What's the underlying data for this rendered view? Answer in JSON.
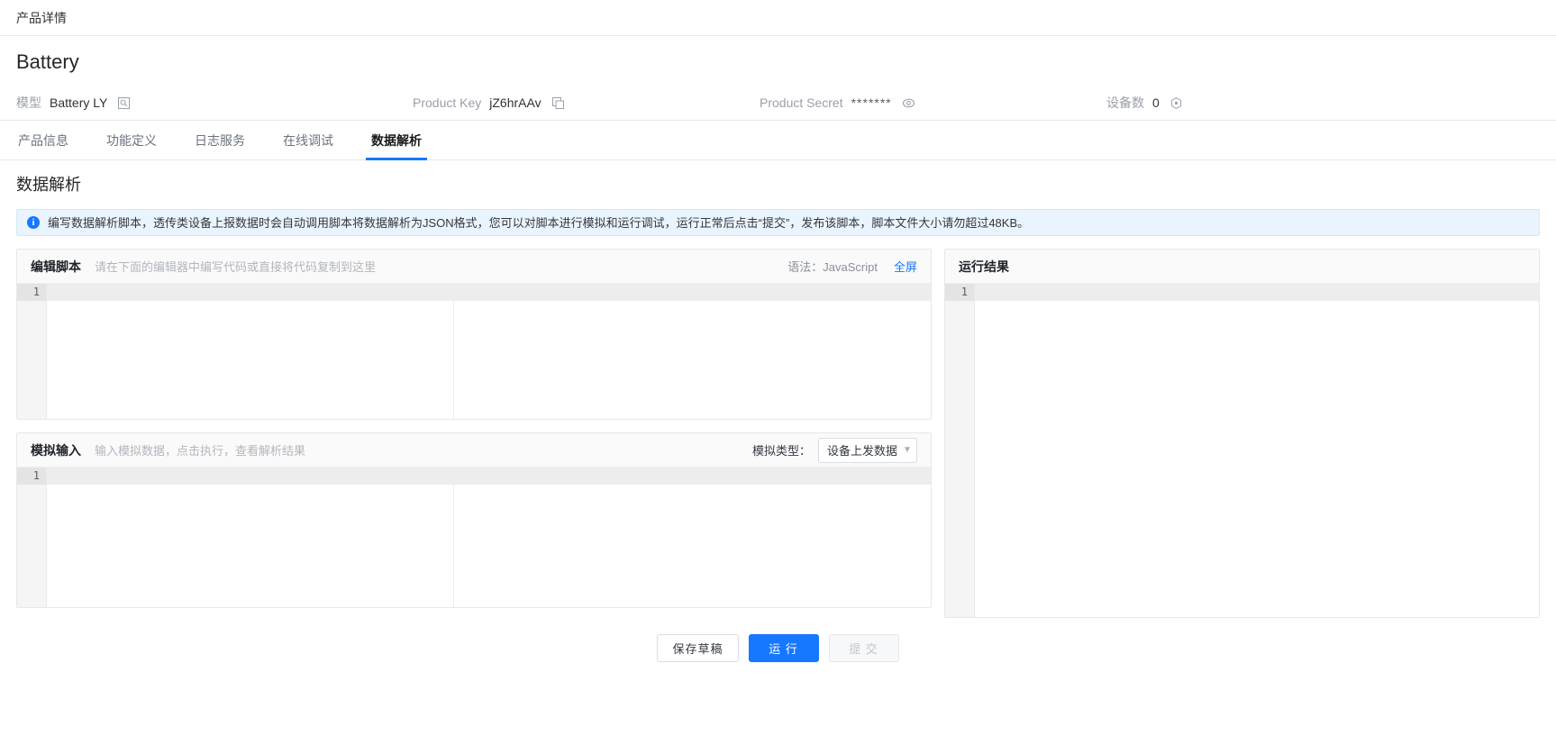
{
  "breadcrumb": {
    "current": "产品详情"
  },
  "product": {
    "name": "Battery",
    "model_label": "模型",
    "model_value": "Battery LY",
    "model_icon": "search-box-icon",
    "product_key_label": "Product Key",
    "product_key_value": "jZ6hrAAv",
    "product_key_icon": "copy-icon",
    "product_secret_label": "Product Secret",
    "product_secret_value": "*******",
    "product_secret_icon": "eye-icon",
    "device_count_label": "设备数",
    "device_count_value": "0",
    "device_count_icon": "target-icon"
  },
  "tabs": [
    {
      "label": "产品信息",
      "active": false
    },
    {
      "label": "功能定义",
      "active": false
    },
    {
      "label": "日志服务",
      "active": false
    },
    {
      "label": "在线调试",
      "active": false
    },
    {
      "label": "数据解析",
      "active": true
    }
  ],
  "page": {
    "title": "数据解析",
    "alert": {
      "icon": "info-icon",
      "glyph": "i",
      "text": "编写数据解析脚本，透传类设备上报数据时会自动调用脚本将数据解析为JSON格式，您可以对脚本进行模拟和运行调试，运行正常后点击“提交”，发布该脚本，脚本文件大小请勿超过48KB。"
    }
  },
  "script_editor": {
    "title": "编辑脚本",
    "hint": "请在下面的编辑器中编写代码或直接将代码复制到这里",
    "syntax_label": "语法：JavaScript",
    "fullscreen_label": "全屏",
    "line_numbers": [
      "1"
    ],
    "lines": [
      ""
    ]
  },
  "sim_input": {
    "title": "模拟输入",
    "hint": "输入模拟数据，点击执行，查看解析结果",
    "sim_type_label": "模拟类型：",
    "sim_type_value": "设备上发数据",
    "sim_type_chevron": "chevron-down-icon",
    "line_numbers": [
      "1"
    ],
    "lines": [
      ""
    ]
  },
  "result": {
    "title": "运行结果",
    "line_numbers": [
      "1"
    ],
    "lines": [
      ""
    ]
  },
  "footer": {
    "save_draft_label": "保存草稿",
    "run_label": "运 行",
    "submit_label": "提 交"
  },
  "colors": {
    "accent": "#1677ff",
    "alert_bg": "#eaf4fe",
    "panel_head_bg": "#fafafa",
    "border": "#e6e8eb"
  }
}
